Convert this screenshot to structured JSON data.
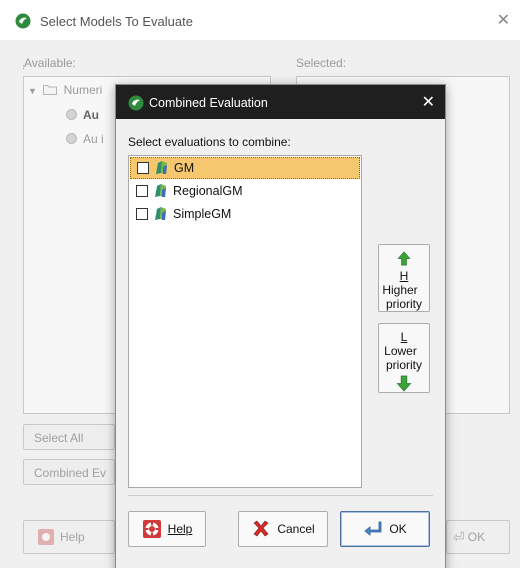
{
  "background_dialog": {
    "title": "Select Models To Evaluate",
    "close_glyph": "✕",
    "available_label": "Available:",
    "selected_label": "Selected:",
    "tree": {
      "folder_label": "Numeri",
      "items": [
        "Au",
        "Au i"
      ]
    },
    "select_all_label": "Select All",
    "combined_label": "Combined Ev",
    "help_label": "Help",
    "ok_label": "OK"
  },
  "modal": {
    "title": "Combined Evaluation",
    "close_glyph": "✕",
    "prompt": "Select evaluations to combine:",
    "evaluations": [
      {
        "label": "GM",
        "checked": false,
        "selected": true
      },
      {
        "label": "RegionalGM",
        "checked": false,
        "selected": false
      },
      {
        "label": "SimpleGM",
        "checked": false,
        "selected": false
      }
    ],
    "higher_priority": {
      "line1": "Higher",
      "line2": "priority"
    },
    "lower_priority": {
      "line1": "Lower",
      "line2": "priority"
    },
    "buttons": {
      "help": "Help",
      "cancel": "Cancel",
      "ok": "OK"
    }
  },
  "colors": {
    "titlebar_dark": "#1f1f1f",
    "selection": "#f5c76e",
    "arrow_green": "#3aa33a",
    "app_icon_green": "#2e8b3e"
  }
}
